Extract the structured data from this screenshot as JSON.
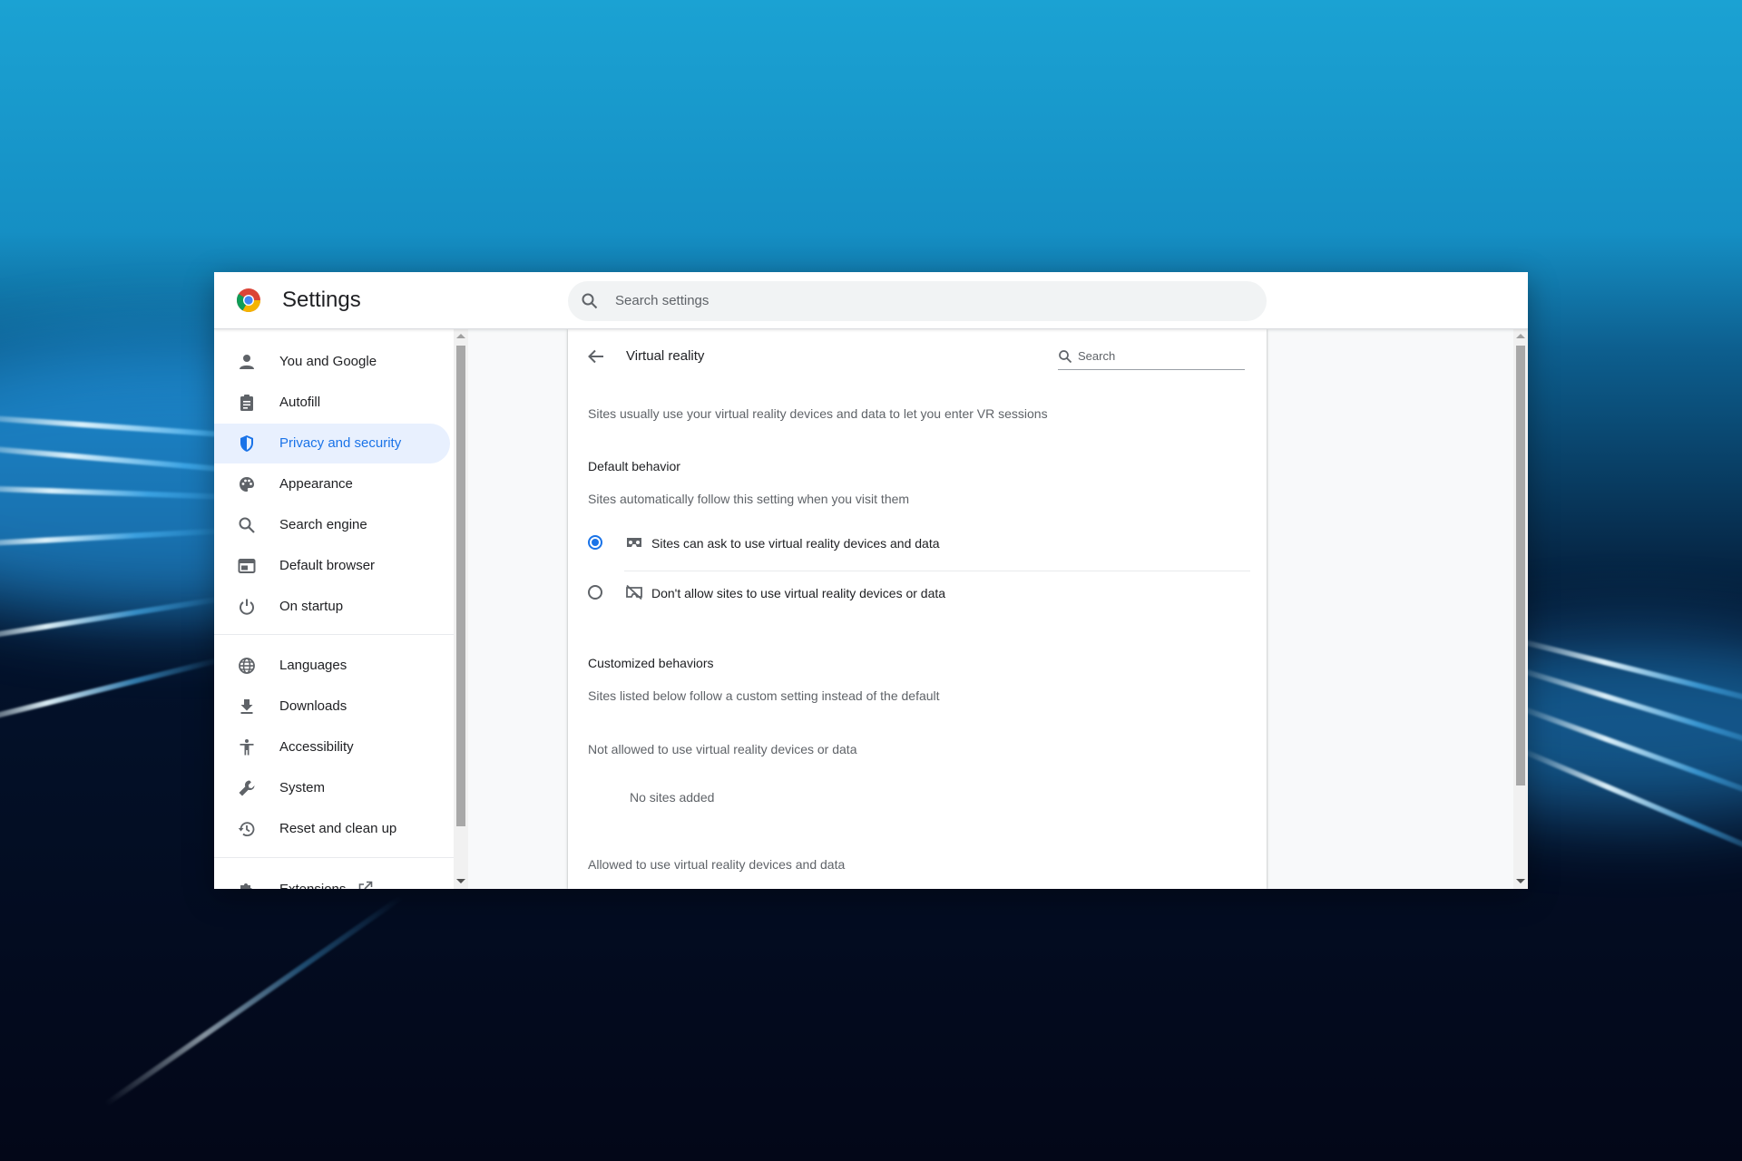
{
  "app": {
    "title": "Settings",
    "search_placeholder": "Search settings"
  },
  "sidebar": {
    "items": [
      {
        "label": "You and Google",
        "icon": "person-icon"
      },
      {
        "label": "Autofill",
        "icon": "clipboard-icon"
      },
      {
        "label": "Privacy and security",
        "icon": "shield-icon",
        "active": true
      },
      {
        "label": "Appearance",
        "icon": "palette-icon"
      },
      {
        "label": "Search engine",
        "icon": "search-icon"
      },
      {
        "label": "Default browser",
        "icon": "browser-window-icon"
      },
      {
        "label": "On startup",
        "icon": "power-icon"
      },
      {
        "label": "Languages",
        "icon": "globe-icon"
      },
      {
        "label": "Downloads",
        "icon": "download-icon"
      },
      {
        "label": "Accessibility",
        "icon": "accessibility-icon"
      },
      {
        "label": "System",
        "icon": "wrench-icon"
      },
      {
        "label": "Reset and clean up",
        "icon": "restore-icon"
      },
      {
        "label": "Extensions",
        "icon": "puzzle-icon"
      }
    ]
  },
  "page": {
    "title": "Virtual reality",
    "search_placeholder": "Search",
    "description": "Sites usually use your virtual reality devices and data to let you enter VR sessions",
    "default_behavior": {
      "heading": "Default behavior",
      "subtext": "Sites automatically follow this setting when you visit them",
      "options": [
        {
          "label": "Sites can ask to use virtual reality devices and data",
          "selected": true,
          "icon": "vr-headset-icon"
        },
        {
          "label": "Don't allow sites to use virtual reality devices or data",
          "selected": false,
          "icon": "vr-headset-off-icon"
        }
      ]
    },
    "customized": {
      "heading": "Customized behaviors",
      "subtext": "Sites listed below follow a custom setting instead of the default",
      "not_allowed_heading": "Not allowed to use virtual reality devices or data",
      "not_allowed_empty": "No sites added",
      "allowed_heading": "Allowed to use virtual reality devices and data"
    }
  },
  "colors": {
    "accent": "#1a73e8",
    "active_bg": "#e8f0fe",
    "text_primary": "#202124",
    "text_secondary": "#5f6368"
  }
}
